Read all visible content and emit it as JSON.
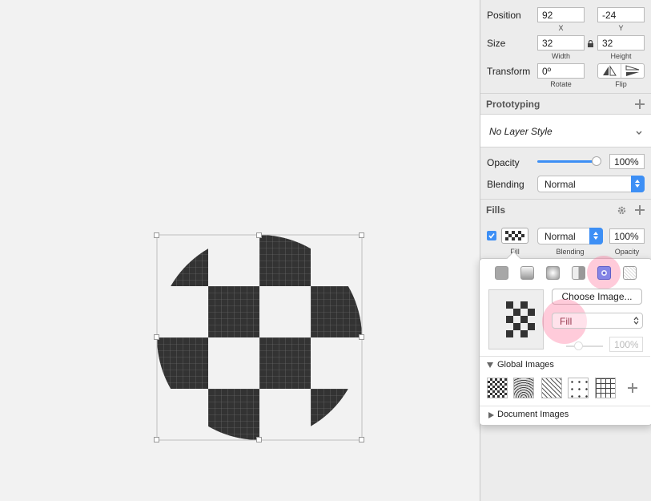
{
  "inspector": {
    "position": {
      "label": "Position",
      "x": "92",
      "y": "-24",
      "x_label": "X",
      "y_label": "Y"
    },
    "size": {
      "label": "Size",
      "width": "32",
      "height": "32",
      "width_label": "Width",
      "height_label": "Height"
    },
    "transform": {
      "label": "Transform",
      "rotate": "0º",
      "rotate_label": "Rotate",
      "flip_label": "Flip"
    },
    "prototyping": {
      "title": "Prototyping"
    },
    "layer_style": {
      "value": "No Layer Style"
    },
    "opacity": {
      "label": "Opacity",
      "value": "100%",
      "slider_fraction": 1.0
    },
    "blending": {
      "label": "Blending",
      "value": "Normal"
    },
    "fills": {
      "title": "Fills",
      "row": {
        "checked": true,
        "fill_label": "Fill",
        "blending": "Normal",
        "blending_label": "Blending",
        "opacity": "100%",
        "opacity_label": "Opacity"
      }
    }
  },
  "popover": {
    "fill_types": [
      "solid-fill",
      "linear-gradient",
      "radial-gradient",
      "angular-gradient",
      "pattern-fill",
      "noise-fill"
    ],
    "selected_fill_type": "pattern-fill",
    "choose_image_label": "Choose Image...",
    "mode": {
      "value": "Fill"
    },
    "opacity_value": "100%",
    "global_images": {
      "title": "Global Images",
      "items": [
        "checker-pattern",
        "wave-pattern",
        "diagonal-lines-pattern",
        "dots-pattern",
        "grid-pattern"
      ]
    },
    "document_images": {
      "title": "Document Images"
    }
  },
  "colors": {
    "accent": "#3d8ff5",
    "highlight": "#ff6996",
    "pattern_dark": "#333333"
  }
}
